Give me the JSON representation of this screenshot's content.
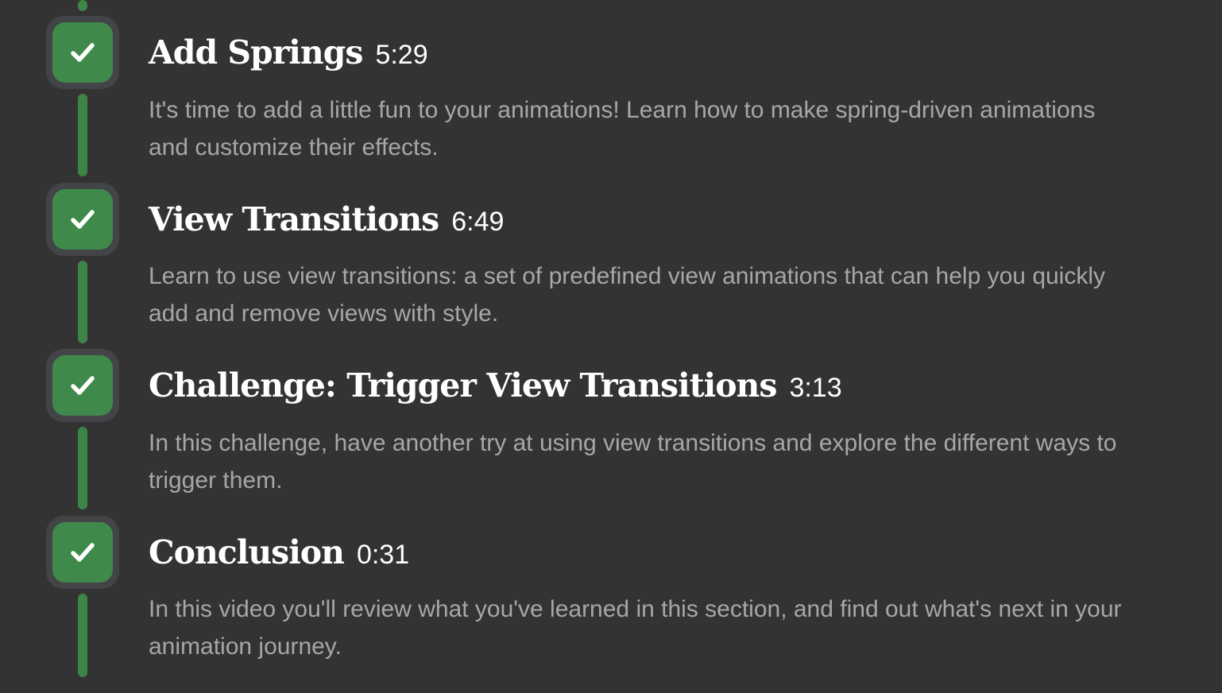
{
  "colors": {
    "background": "#333333",
    "accent_green": "#3f8a4a",
    "badge_ring": "#434447",
    "title_text": "#ffffff",
    "description_text": "#a7a7ab"
  },
  "lessons": [
    {
      "icon": "checkmark-icon",
      "completed": true,
      "title": "Add Springs",
      "duration": "5:29",
      "description": "It's time to add a little fun to your animations! Learn how to make spring-driven animations and customize their effects."
    },
    {
      "icon": "checkmark-icon",
      "completed": true,
      "title": "View Transitions",
      "duration": "6:49",
      "description": "Learn to use view transitions: a set of predefined view animations that can help you quickly add and remove views with style."
    },
    {
      "icon": "checkmark-icon",
      "completed": true,
      "title": "Challenge: Trigger View Transitions",
      "duration": "3:13",
      "description": "In this challenge, have another try at using view transitions and explore the different ways to trigger them."
    },
    {
      "icon": "checkmark-icon",
      "completed": true,
      "title": "Conclusion",
      "duration": "0:31",
      "description": "In this video you'll review what you've learned in this section, and find out what's next in your animation journey."
    }
  ]
}
